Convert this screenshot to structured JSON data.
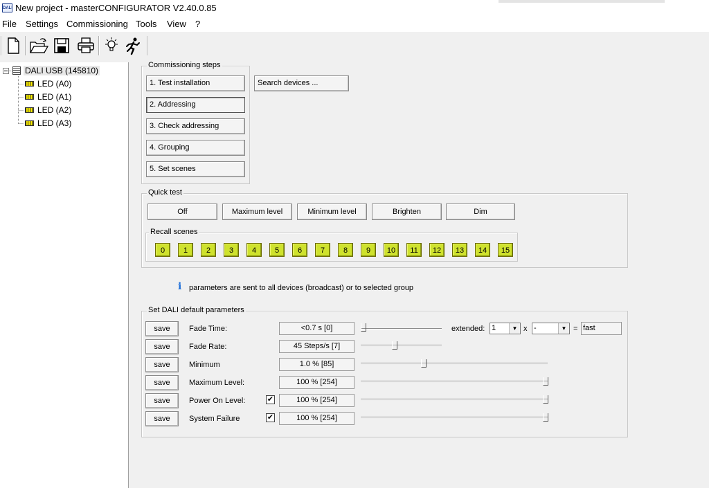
{
  "window": {
    "title": "New project - masterCONFIGURATOR V2.40.0.85",
    "icon_text": "DALI"
  },
  "menu": [
    "File",
    "Settings",
    "Commissioning",
    "Tools",
    "View",
    "?"
  ],
  "toolbar": [
    "new-document-icon",
    "open-folder-icon",
    "save-disk-icon",
    "print-icon",
    "light-bulb-icon",
    "running-man-icon"
  ],
  "tree": {
    "root": "DALI USB (145810)",
    "children": [
      "LED (A0)",
      "LED (A1)",
      "LED (A2)",
      "LED (A3)"
    ]
  },
  "commissioning": {
    "title": "Commissioning steps",
    "steps": [
      "1. Test installation",
      "2. Addressing",
      "3. Check addressing",
      "4. Grouping",
      "5. Set scenes"
    ],
    "search_button": "Search devices ..."
  },
  "quick_test": {
    "title": "Quick test",
    "buttons": [
      "Off",
      "Maximum level",
      "Minimum level",
      "Brighten",
      "Dim"
    ],
    "recall_title": "Recall scenes",
    "scenes": [
      "0",
      "1",
      "2",
      "3",
      "4",
      "5",
      "6",
      "7",
      "8",
      "9",
      "10",
      "11",
      "12",
      "13",
      "14",
      "15"
    ]
  },
  "info_text": "parameters are sent to all devices (broadcast) or to selected group",
  "defaults": {
    "title": "Set DALI default parameters",
    "save_label": "save",
    "rows": [
      {
        "label": "Fade Time:",
        "value": "<0.7  s [0]",
        "checkbox": false,
        "level": 0
      },
      {
        "label": "Fade Rate:",
        "value": "45  Steps/s [7]",
        "checkbox": false,
        "level": 0.47
      },
      {
        "label": "Minimum",
        "value": "1.0 % [85]",
        "checkbox": false,
        "level": 0.33
      },
      {
        "label": "Maximum Level:",
        "value": "100 % [254]",
        "checkbox": false,
        "level": 1
      },
      {
        "label": "Power On Level:",
        "value": "100 % [254]",
        "checkbox": true,
        "level": 1
      },
      {
        "label": "System Failure",
        "value": "100 % [254]",
        "checkbox": true,
        "level": 1
      }
    ],
    "extended_label": "extended:",
    "extended_value": "1",
    "times_sign": "x",
    "multiplier_value": "-",
    "equals_sign": "=",
    "result_value": "fast"
  }
}
